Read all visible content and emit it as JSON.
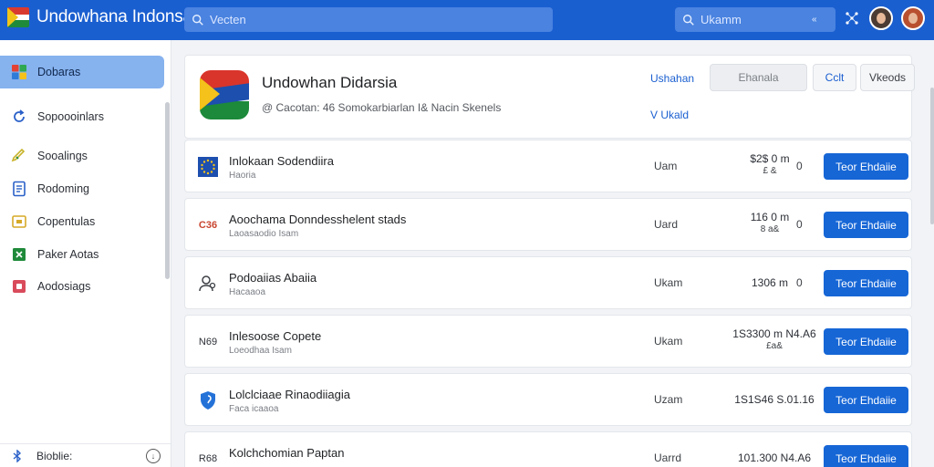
{
  "header": {
    "brand_title": "Undowhana Indonsai",
    "search_placeholder": "Vecten",
    "search2_placeholder": "Ukamm",
    "search2_chevron": "«"
  },
  "sidebar": {
    "items": [
      {
        "label": "Dobaras",
        "icon": "windows-logo-icon",
        "color": "#2f7bd8"
      },
      {
        "label": "Sopoooinlars",
        "icon": "sync-icon",
        "color": "#2a60c8"
      },
      {
        "label": "Sooalings",
        "icon": "pencil-check-icon",
        "color": "#c8b32a"
      },
      {
        "label": "Rodoming",
        "icon": "document-icon",
        "color": "#2a60c8"
      },
      {
        "label": "Copentulas",
        "icon": "folder-icon",
        "color": "#d6a927"
      },
      {
        "label": "Paker Aotas",
        "icon": "spreadsheet-icon",
        "color": "#1f8a3a"
      },
      {
        "label": "Aodosiags",
        "icon": "media-icon",
        "color": "#d94b5b"
      }
    ],
    "footer_label": "Bioblie:",
    "footer_down": "↓"
  },
  "app": {
    "title": "Undowhan Didarsia",
    "subtitle": "@ Cacotan: 46 Somokarbiarlan I& Nacin Skenels",
    "link1": "Ushahan",
    "link2": "V Ukald",
    "btn1": "Ehanala",
    "btn2": "Cclt",
    "btn3": "Vkeods"
  },
  "rows": [
    {
      "name": "Inlokaan Sodendiira",
      "sub": "Haoria",
      "status": "Uam",
      "size": "$2$ 0 m",
      "size2": "£ &",
      "count": "0",
      "button": "Teor Ehdaiie",
      "icon": "eu-flag-icon"
    },
    {
      "name": "Aoochama Donndesshelent stads",
      "sub": "Laoasaodio Isam",
      "status": "Uard",
      "size": "116 0 m",
      "size2": "8 a&",
      "count": "0",
      "button": "Teor Ehdaiie",
      "icon": "badge-text-icon",
      "icon_text": "C36"
    },
    {
      "name": "Podoaiias Abaiia",
      "sub": "Hacaaoa",
      "status": "Ukam",
      "size": "1306 m",
      "size2": "",
      "count": "0",
      "button": "Teor Ehdaiie",
      "icon": "users-icon"
    },
    {
      "name": "Inlesoose Copete",
      "sub": "Loeodhaa Isam",
      "status": "Ukam",
      "size": "1S3300 m N4.A6",
      "size2": "£a&",
      "count": "",
      "button": "Teor Ehdaiie",
      "icon": "badge-text-icon",
      "icon_text": "N69"
    },
    {
      "name": "Lolclciaae Rinaodiiagia",
      "sub": "Faca icaaoa",
      "status": "Uzam",
      "size": "1S1S46 S.01.16",
      "size2": "",
      "count": "",
      "button": "Teor Ehdaiie",
      "icon": "shield-icon"
    },
    {
      "name": "Kolchchomian Paptan",
      "sub": "",
      "status": "Uarrd",
      "size": "101.300 N4.A6",
      "size2": "",
      "count": "",
      "button": "Teor Ehdaiie",
      "icon": "badge-text-icon",
      "icon_text": "R68"
    }
  ],
  "colors": {
    "topbar": "#1a5fd0",
    "accent_button": "#1666d6",
    "active_item": "#86b2ee"
  }
}
